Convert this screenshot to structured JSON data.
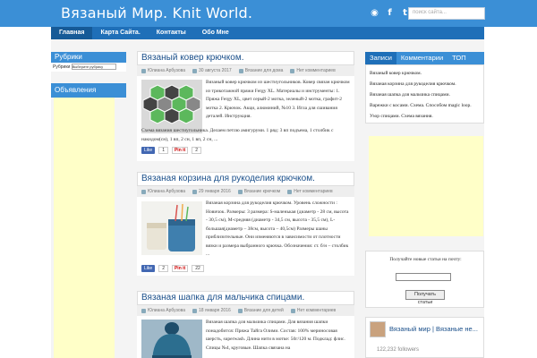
{
  "header": {
    "title": "Вязаный Мир. Knit World.",
    "search_placeholder": "поиск сайта...",
    "social": {
      "rss": "◉",
      "facebook": "f",
      "twitter": "t"
    }
  },
  "nav": [
    "Главная",
    "Карта Сайта.",
    "Контакты",
    "Обо Мне"
  ],
  "left_sidebar": {
    "rubrics_title": "Рубрики",
    "rubrics_label": "Рубрики",
    "rubrics_select": "Выберите рубрику",
    "ads_title": "Объявления"
  },
  "posts": [
    {
      "title": "Вязаный ковер крючком.",
      "author": "Юлиана Арбузова",
      "date": "30 августа 2017",
      "category": "Вязание для дома",
      "comments": "Нет комментариев",
      "excerpt": "Вязаный ковер крючком из шестиугольников. Ковер связан крючком из трикотажной пряжи Fergy XL. Материалы и инструменты: 1. Пряжа Fergy XL, цвет серый-2 мотка, зеленый-2 мотка, графит-2 мотка 2. Крючок. Акци, алюминий, №10 3. Игла для сшивания деталей. Инструкция.",
      "excerpt_cont": "Схема вязания шестиугольника. Делаем петлю амигуруми. 1 ряд: 3 вп подъема, 1 столбик с накидом(сн), 1 вп, 2 сн, 1 вп, 2 сн, ...",
      "likes": "1",
      "pins": "2"
    },
    {
      "title": "Вязаная корзина для рукоделия крючком.",
      "author": "Юлиана Арбузова",
      "date": "29 января 2016",
      "category": "Вязание крючком",
      "comments": "Нет комментариев",
      "excerpt": "Вязаная корзина для рукоделия крючком. Уровень сложности : Новичок. Размеры: 3 размера: S-маленькая (диаметр - 28 см, высота - 30,5 см), M-средняя (диаметр - 34,5 см, высота - 35,5 см), L-большая(диаметр – 38см, высота – 40,5см) Размеры шаны приблизительные. Они изменяются в зависимости от плотности вязки и размера выбранного крючка. Обозначения: ст. б/н – столбик ...",
      "likes": "2",
      "pins": "22"
    },
    {
      "title": "Вязаная шапка для мальчика спицами.",
      "author": "Юлиана Арбузова",
      "date": "18 января 2016",
      "category": "Вязание для детей",
      "comments": "Нет комментариев",
      "excerpt": "Вязаная шапка для мальчика спицами. Для вязания шапки понадобится: Пряжа Тайга Олими. Состав: 100% мериносовая шерсть, superwash. Длина нити в мотке: 50г/120 м. Подклад: флис. Спицы №4, круговые. Шапка связана на"
    }
  ],
  "right_sidebar": {
    "tabs": [
      "Записи",
      "Комментарии",
      "ТОП"
    ],
    "recent": [
      "Вязаный ковер крючком.",
      "Вязаная корзина для рукоделия крючком.",
      "Вязаная шапка для мальчика спицами.",
      "Варежки с косами. Схема. Способом magic loop.",
      "Узор спицами. Схема вязания."
    ],
    "subscribe_label": "Получайте новые статьи на почту:",
    "subscribe_button": "Получать статьи",
    "fb_name": "Вязаный мир | Вязаные не...",
    "fb_followers": "122,232 followers"
  }
}
